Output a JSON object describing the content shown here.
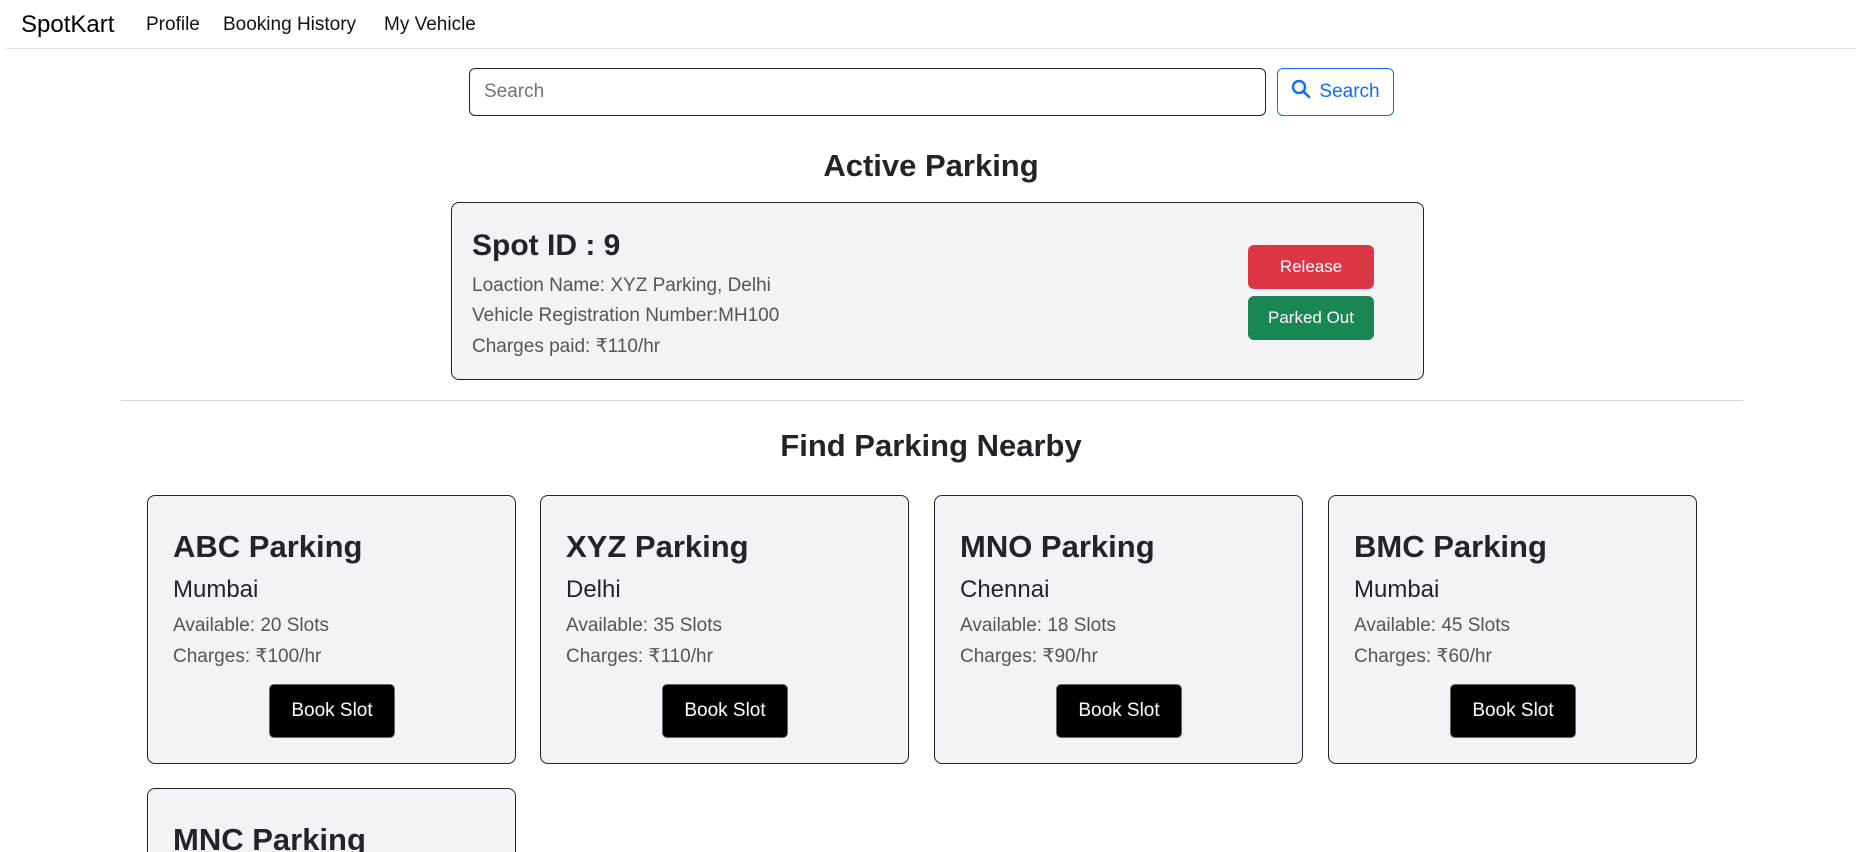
{
  "navbar": {
    "brand": "SpotKart",
    "links": [
      "Profile",
      "Booking History",
      "My Vehicle"
    ]
  },
  "search": {
    "placeholder": "Search",
    "button_label": "Search"
  },
  "active_parking": {
    "title": "Active Parking",
    "spot_id": "Spot ID : 9",
    "location": "Loaction Name: XYZ Parking, Delhi",
    "vehicle": "Vehicle Registration Number:MH100",
    "charges": "Charges paid: ₹110/hr",
    "release_label": "Release",
    "parked_out_label": "Parked Out"
  },
  "nearby": {
    "title": "Find Parking Nearby",
    "book_label": "Book Slot",
    "lots": [
      {
        "name": "ABC Parking",
        "city": "Mumbai",
        "available": "Available: 20 Slots",
        "charges": "Charges: ₹100/hr"
      },
      {
        "name": "XYZ Parking",
        "city": "Delhi",
        "available": "Available: 35 Slots",
        "charges": "Charges: ₹110/hr"
      },
      {
        "name": "MNO Parking",
        "city": "Chennai",
        "available": "Available: 18 Slots",
        "charges": "Charges: ₹90/hr"
      },
      {
        "name": "BMC Parking",
        "city": "Mumbai",
        "available": "Available: 45 Slots",
        "charges": "Charges: ₹60/hr"
      },
      {
        "name": "MNC Parking"
      }
    ]
  },
  "colors": {
    "primary": "#0d6efd",
    "danger": "#dc3545",
    "success": "#198754",
    "card_bg": "#f3f3f7"
  },
  "icons": {
    "search": "magnifier-icon"
  }
}
